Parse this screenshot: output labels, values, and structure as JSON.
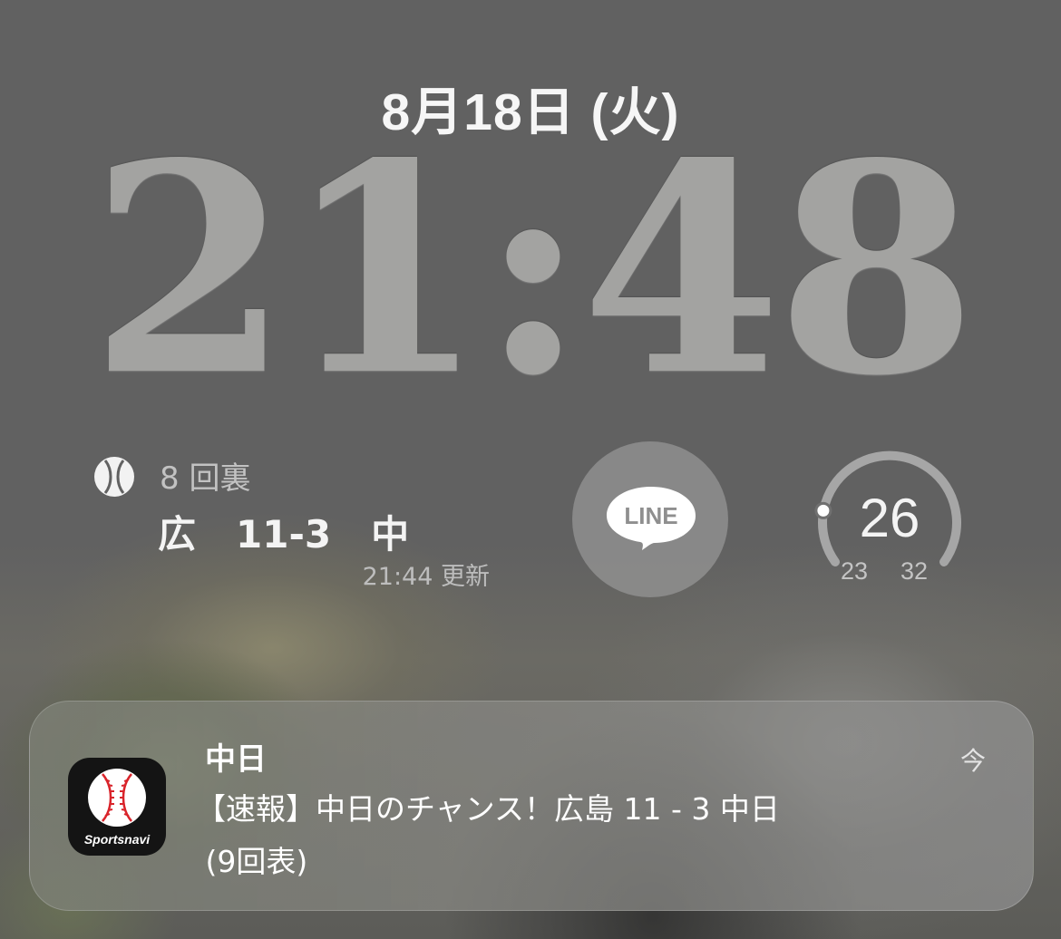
{
  "lock_screen": {
    "date": "8月18日 (火)",
    "time": "21:48"
  },
  "widgets": {
    "baseball": {
      "icon": "baseball-icon",
      "inning": "8 回裏",
      "team_home": "広",
      "score": "11-3",
      "team_away": "中",
      "updated": "21:44 更新"
    },
    "line": {
      "icon": "line-app-icon",
      "label": "LINE",
      "color": "#9a9a9a"
    },
    "temperature": {
      "current": "26",
      "low": "23",
      "high": "32",
      "gauge_position": 0.2
    }
  },
  "notification": {
    "app_icon": "sportsnavi-app-icon",
    "app_icon_label": "Sportsnavi",
    "title": "中日",
    "time": "今",
    "body_line1": "【速報】中日のチャンス！広島 11 - 3 中日",
    "body_line2": " (9回表)"
  }
}
